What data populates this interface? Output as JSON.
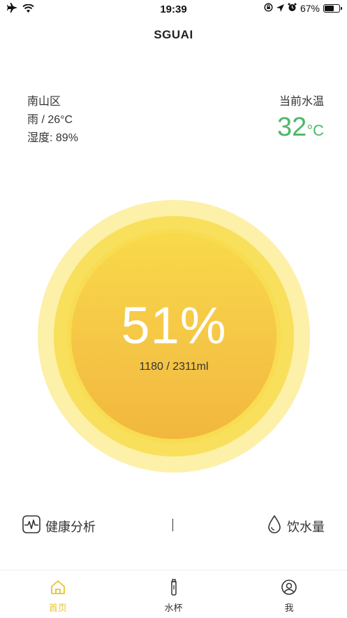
{
  "status_bar": {
    "time": "19:39",
    "battery_text": "67%",
    "battery_level": 0.67,
    "icons": [
      "airplane-icon",
      "wifi-icon",
      "lock-rotation-icon",
      "location-icon",
      "alarm-icon",
      "battery-icon"
    ]
  },
  "nav": {
    "title": "SGUAI"
  },
  "weather": {
    "district": "南山区",
    "condition": "雨 / 26°C",
    "humidity": "湿度: 89%"
  },
  "water_temp": {
    "label": "当前水温",
    "value": "32",
    "unit": "°C",
    "color": "#4cb86a"
  },
  "gauge": {
    "percent_text": "51%",
    "percent": 51,
    "amount_text": "1180 / 2311ml",
    "colors": {
      "outer": "#fdf0a8",
      "middle": "#f8e05c",
      "inner": "#f5c646"
    }
  },
  "actions": {
    "health_label": "健康分析",
    "health_icon": "heartbeat-icon",
    "divider": "|",
    "intake_label": "饮水量",
    "intake_icon": "water-drop-icon"
  },
  "tabs": [
    {
      "label": "首页",
      "icon": "home-icon",
      "active": true
    },
    {
      "label": "水杯",
      "icon": "bottle-icon",
      "active": false
    },
    {
      "label": "我",
      "icon": "user-icon",
      "active": false
    }
  ],
  "accent_color": "#e8c52b"
}
